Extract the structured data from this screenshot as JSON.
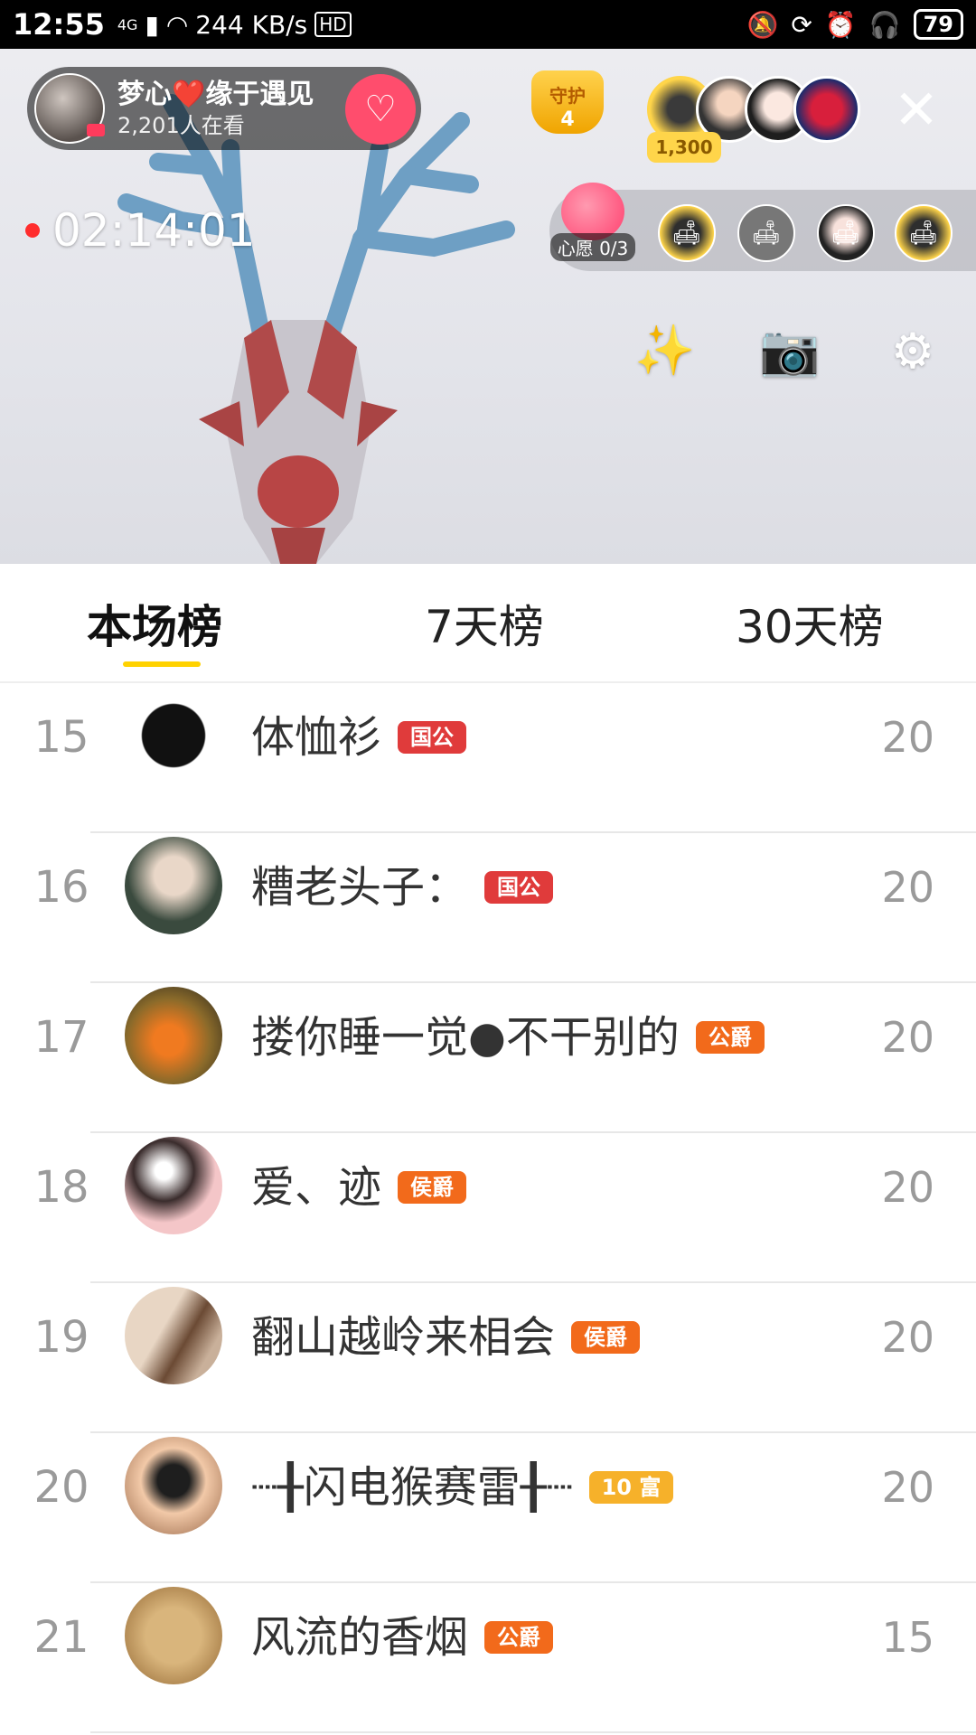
{
  "status_bar": {
    "time": "12:55",
    "network": "4G",
    "speed": "244 KB/s",
    "hd": "HD",
    "battery": "79"
  },
  "live": {
    "host_name": "梦心❤️缘于遇见",
    "viewers": "2,201人在看",
    "guard_label": "守护",
    "guard_count": "4",
    "top_viewer_score": "1,300",
    "timer": "02:14:01",
    "wish_label": "心愿 0/3"
  },
  "tabs": [
    {
      "label": "本场榜"
    },
    {
      "label": "7天榜"
    },
    {
      "label": "30天榜"
    }
  ],
  "colors": {
    "accent": "#ffd200",
    "live_dot": "#ff2d2d",
    "follow": "#ff4d6d"
  },
  "ranking": [
    {
      "rank": "15",
      "name": "体恤衫",
      "badge": "国公",
      "score": "20"
    },
    {
      "rank": "16",
      "name": "糟老头子：",
      "badge": "国公",
      "score": "20"
    },
    {
      "rank": "17",
      "name": "搂你睡一觉●不干别的",
      "badge": "公爵",
      "score": "20"
    },
    {
      "rank": "18",
      "name": "爱、迹",
      "badge": "侯爵",
      "score": "20"
    },
    {
      "rank": "19",
      "name": "翻山越岭来相会",
      "badge": "侯爵",
      "score": "20"
    },
    {
      "rank": "20",
      "name": "┈╂闪电猴赛雷╂┈",
      "badge": "10 富",
      "score": "20"
    },
    {
      "rank": "21",
      "name": "风流的香烟",
      "badge": "公爵",
      "score": "15"
    }
  ]
}
